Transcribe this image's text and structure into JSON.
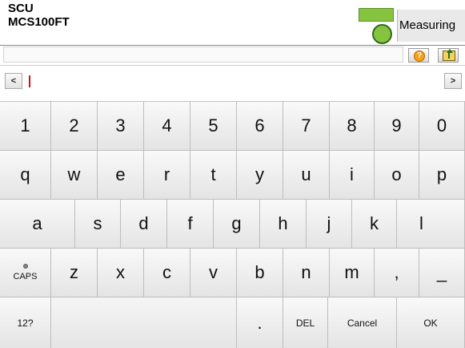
{
  "header": {
    "device_line1": "SCU",
    "device_line2": "MCS100FT",
    "status_text": "Measuring",
    "status_color": "#86c440"
  },
  "toolbar": {
    "help_icon": "help-icon",
    "help_glyph": "?",
    "folder_up_icon": "folder-up-icon"
  },
  "input": {
    "value": "",
    "scroll_left": "<",
    "scroll_right": ">"
  },
  "keyboard": {
    "row1": [
      "1",
      "2",
      "3",
      "4",
      "5",
      "6",
      "7",
      "8",
      "9",
      "0"
    ],
    "row2": [
      "q",
      "w",
      "e",
      "r",
      "t",
      "y",
      "u",
      "i",
      "o",
      "p"
    ],
    "row3": [
      "a",
      "s",
      "d",
      "f",
      "g",
      "h",
      "j",
      "k",
      "l"
    ],
    "row4": [
      "CAPS",
      "z",
      "x",
      "c",
      "v",
      "b",
      "n",
      "m",
      ",",
      "_"
    ],
    "row5": {
      "mode": "12?",
      "space": "",
      "period": ".",
      "del": "DEL",
      "cancel": "Cancel",
      "ok": "OK"
    }
  }
}
